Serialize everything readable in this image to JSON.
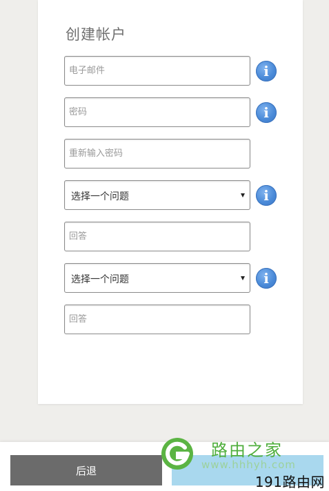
{
  "form": {
    "title": "创建帐户",
    "email_placeholder": "电子邮件",
    "password_placeholder": "密码",
    "confirm_placeholder": "重新输入密码",
    "question1_selected": "选择一个问题",
    "answer1_placeholder": "回答",
    "question2_selected": "选择一个问题",
    "answer2_placeholder": "回答",
    "info_glyph": "i"
  },
  "footer": {
    "back_label": "后退",
    "next_label": ""
  },
  "watermark": {
    "brand": "路由之家",
    "url": "www.hhhyh.com",
    "site": "191路由网"
  },
  "colors": {
    "info_blue": "#4a8ad8",
    "back_button": "#6b6b6b",
    "next_button": "#a9d8ee",
    "watermark_green": "#4fae3c"
  },
  "icons": {
    "info": "info-circle-icon",
    "logo": "router-home-logo-icon"
  }
}
